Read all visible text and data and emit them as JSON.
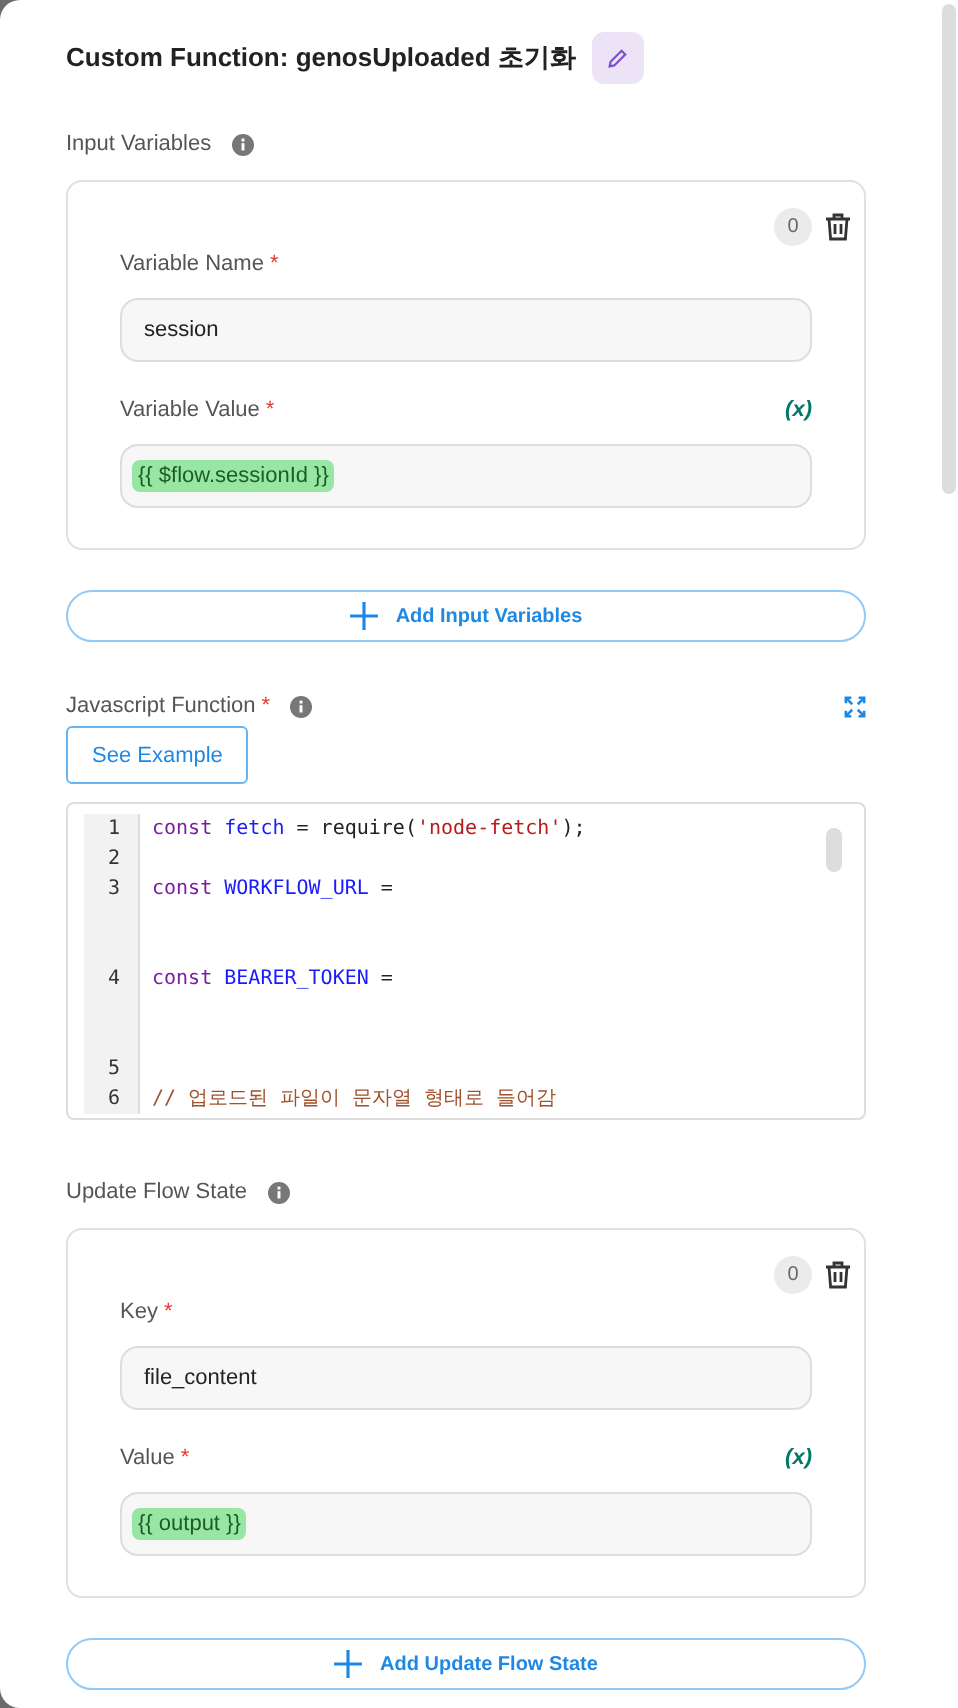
{
  "title": "Custom Function: genosUploaded 초기화",
  "input_variables": {
    "label": "Input Variables",
    "items": [
      {
        "badge": "0",
        "fields": [
          {
            "label": "Variable Name",
            "required_mark": "*",
            "value": "session",
            "is_variable": false
          },
          {
            "label": "Variable Value",
            "required_mark": "*",
            "variable_button": "(x)",
            "value": "{{ $flow.sessionId }}",
            "is_variable": true
          }
        ]
      }
    ],
    "add_button": "Add Input Variables"
  },
  "javascript_function": {
    "label": "Javascript Function",
    "required_mark": "*",
    "example_button": "See Example",
    "lines": [
      {
        "number": "1",
        "kind": "normal",
        "tokens": [
          {
            "color": "#7b1fa2",
            "text": "const"
          },
          {
            "color": "#1a1aff",
            "text": " fetch"
          },
          {
            "color": "#222222",
            "text": " = require("
          },
          {
            "color": "#b71c1c",
            "text": "'node-fetch'"
          },
          {
            "color": "#222222",
            "text": ");"
          }
        ]
      },
      {
        "number": "2",
        "kind": "normal"
      },
      {
        "number": "3",
        "kind": "tall",
        "tokens": [
          {
            "color": "#7b1fa2",
            "text": "const"
          },
          {
            "color": "#1a1aff",
            "text": " WORKFLOW_URL"
          },
          {
            "color": "#222222",
            "text": " ="
          }
        ]
      },
      {
        "number": "4",
        "kind": "tall",
        "tokens": [
          {
            "color": "#7b1fa2",
            "text": "const"
          },
          {
            "color": "#1a1aff",
            "text": " BEARER_TOKEN"
          },
          {
            "color": "#222222",
            "text": " ="
          }
        ]
      },
      {
        "number": "5",
        "kind": "normal"
      },
      {
        "number": "6",
        "kind": "normal",
        "tokens": [
          {
            "color": "#a0522d",
            "text": "// 업로드된 파일이 문자열 형태로 들어감"
          }
        ]
      }
    ]
  },
  "update_flow_state": {
    "label": "Update Flow State",
    "items": [
      {
        "badge": "0",
        "fields": [
          {
            "label": "Key",
            "required_mark": "*",
            "value": "file_content",
            "is_variable": false
          },
          {
            "label": "Value",
            "required_mark": "*",
            "variable_button": "(x)",
            "value": "{{ output }}",
            "is_variable": true
          }
        ]
      }
    ],
    "add_button": "Add Update Flow State"
  }
}
